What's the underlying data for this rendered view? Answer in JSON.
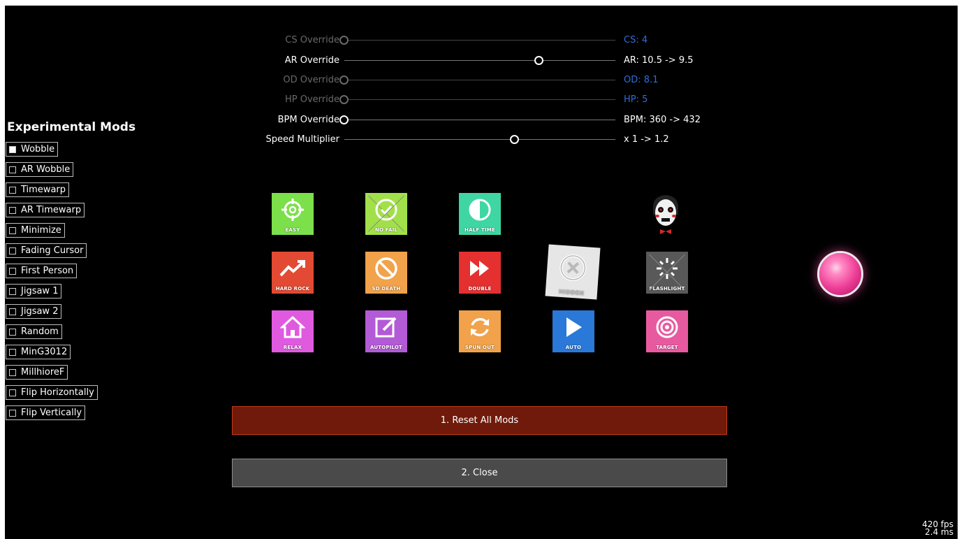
{
  "sliders": [
    {
      "label": "CS Override",
      "value": "CS: 4",
      "dim": true,
      "blue": true,
      "pos": 0.0
    },
    {
      "label": "AR Override",
      "value": "AR: 10.5 -> 9.5",
      "dim": false,
      "blue": false,
      "pos": 0.72
    },
    {
      "label": "OD Override",
      "value": "OD: 8.1",
      "dim": true,
      "blue": true,
      "pos": 0.0
    },
    {
      "label": "HP Override",
      "value": "HP: 5",
      "dim": true,
      "blue": true,
      "pos": 0.0
    },
    {
      "label": "BPM Override",
      "value": "BPM: 360  ->  432",
      "dim": false,
      "blue": false,
      "pos": 0.0
    },
    {
      "label": "Speed Multiplier",
      "value": "x 1 -> 1.2",
      "dim": false,
      "blue": false,
      "pos": 0.63
    }
  ],
  "experimental": {
    "title": "Experimental Mods",
    "items": [
      {
        "label": "Wobble",
        "checked": true
      },
      {
        "label": "AR Wobble",
        "checked": false
      },
      {
        "label": "Timewarp",
        "checked": false
      },
      {
        "label": "AR Timewarp",
        "checked": false
      },
      {
        "label": "Minimize",
        "checked": false
      },
      {
        "label": "Fading Cursor",
        "checked": false
      },
      {
        "label": "First Person",
        "checked": false
      },
      {
        "label": "Jigsaw 1",
        "checked": false
      },
      {
        "label": "Jigsaw 2",
        "checked": false
      },
      {
        "label": "Random",
        "checked": false
      },
      {
        "label": "MinG3012",
        "checked": false
      },
      {
        "label": "MillhioreF",
        "checked": false
      },
      {
        "label": "Flip Horizontally",
        "checked": false
      },
      {
        "label": "Flip Vertically",
        "checked": false
      }
    ]
  },
  "mods": {
    "easy": {
      "label": "EASY",
      "color": "#7be04a"
    },
    "nofail": {
      "label": "NO FAIL",
      "color": "#a2e04a"
    },
    "halftime": {
      "label": "HALF TIME",
      "color": "#3fd6a4"
    },
    "hardrock": {
      "label": "HARD ROCK",
      "color": "#e34a33"
    },
    "suddendeath": {
      "label": "SD DEATH",
      "color": "#f1a24a"
    },
    "double": {
      "label": "DOUBLE",
      "color": "#e53030"
    },
    "hidden": {
      "label": "HIDDEN",
      "color": "#e6e6e6"
    },
    "flashlight": {
      "label": "FLASHLIGHT",
      "color": "#595959"
    },
    "relax": {
      "label": "RELAX",
      "color": "#e05ae0"
    },
    "autopilot": {
      "label": "AUTOPILOT",
      "color": "#b35ad6"
    },
    "spunout": {
      "label": "SPUN OUT",
      "color": "#f1a24a"
    },
    "auto": {
      "label": "AUTO",
      "color": "#2a78d8"
    },
    "target": {
      "label": "TARGET",
      "color": "#e85aa0"
    }
  },
  "buttons": {
    "reset": "1. Reset All Mods",
    "close": "2. Close"
  },
  "stats": {
    "fps": "420 fps",
    "ms": "2.4 ms"
  }
}
